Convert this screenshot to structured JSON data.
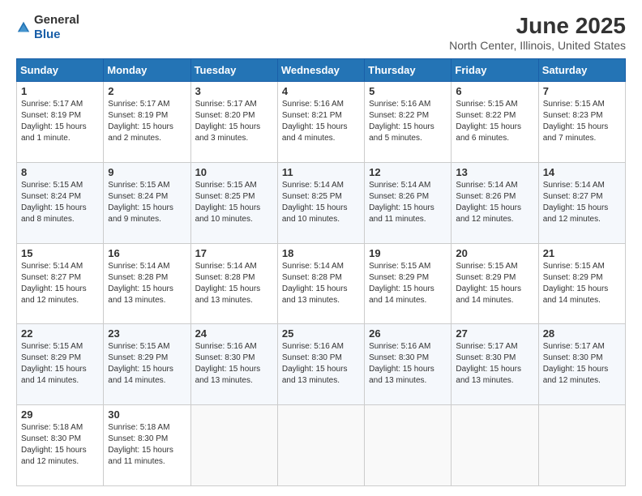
{
  "header": {
    "logo_general": "General",
    "logo_blue": "Blue",
    "title": "June 2025",
    "subtitle": "North Center, Illinois, United States"
  },
  "calendar": {
    "days_of_week": [
      "Sunday",
      "Monday",
      "Tuesday",
      "Wednesday",
      "Thursday",
      "Friday",
      "Saturday"
    ],
    "weeks": [
      [
        {
          "day": "1",
          "info": "Sunrise: 5:17 AM\nSunset: 8:19 PM\nDaylight: 15 hours\nand 1 minute."
        },
        {
          "day": "2",
          "info": "Sunrise: 5:17 AM\nSunset: 8:19 PM\nDaylight: 15 hours\nand 2 minutes."
        },
        {
          "day": "3",
          "info": "Sunrise: 5:17 AM\nSunset: 8:20 PM\nDaylight: 15 hours\nand 3 minutes."
        },
        {
          "day": "4",
          "info": "Sunrise: 5:16 AM\nSunset: 8:21 PM\nDaylight: 15 hours\nand 4 minutes."
        },
        {
          "day": "5",
          "info": "Sunrise: 5:16 AM\nSunset: 8:22 PM\nDaylight: 15 hours\nand 5 minutes."
        },
        {
          "day": "6",
          "info": "Sunrise: 5:15 AM\nSunset: 8:22 PM\nDaylight: 15 hours\nand 6 minutes."
        },
        {
          "day": "7",
          "info": "Sunrise: 5:15 AM\nSunset: 8:23 PM\nDaylight: 15 hours\nand 7 minutes."
        }
      ],
      [
        {
          "day": "8",
          "info": "Sunrise: 5:15 AM\nSunset: 8:24 PM\nDaylight: 15 hours\nand 8 minutes."
        },
        {
          "day": "9",
          "info": "Sunrise: 5:15 AM\nSunset: 8:24 PM\nDaylight: 15 hours\nand 9 minutes."
        },
        {
          "day": "10",
          "info": "Sunrise: 5:15 AM\nSunset: 8:25 PM\nDaylight: 15 hours\nand 10 minutes."
        },
        {
          "day": "11",
          "info": "Sunrise: 5:14 AM\nSunset: 8:25 PM\nDaylight: 15 hours\nand 10 minutes."
        },
        {
          "day": "12",
          "info": "Sunrise: 5:14 AM\nSunset: 8:26 PM\nDaylight: 15 hours\nand 11 minutes."
        },
        {
          "day": "13",
          "info": "Sunrise: 5:14 AM\nSunset: 8:26 PM\nDaylight: 15 hours\nand 12 minutes."
        },
        {
          "day": "14",
          "info": "Sunrise: 5:14 AM\nSunset: 8:27 PM\nDaylight: 15 hours\nand 12 minutes."
        }
      ],
      [
        {
          "day": "15",
          "info": "Sunrise: 5:14 AM\nSunset: 8:27 PM\nDaylight: 15 hours\nand 12 minutes."
        },
        {
          "day": "16",
          "info": "Sunrise: 5:14 AM\nSunset: 8:28 PM\nDaylight: 15 hours\nand 13 minutes."
        },
        {
          "day": "17",
          "info": "Sunrise: 5:14 AM\nSunset: 8:28 PM\nDaylight: 15 hours\nand 13 minutes."
        },
        {
          "day": "18",
          "info": "Sunrise: 5:14 AM\nSunset: 8:28 PM\nDaylight: 15 hours\nand 13 minutes."
        },
        {
          "day": "19",
          "info": "Sunrise: 5:15 AM\nSunset: 8:29 PM\nDaylight: 15 hours\nand 14 minutes."
        },
        {
          "day": "20",
          "info": "Sunrise: 5:15 AM\nSunset: 8:29 PM\nDaylight: 15 hours\nand 14 minutes."
        },
        {
          "day": "21",
          "info": "Sunrise: 5:15 AM\nSunset: 8:29 PM\nDaylight: 15 hours\nand 14 minutes."
        }
      ],
      [
        {
          "day": "22",
          "info": "Sunrise: 5:15 AM\nSunset: 8:29 PM\nDaylight: 15 hours\nand 14 minutes."
        },
        {
          "day": "23",
          "info": "Sunrise: 5:15 AM\nSunset: 8:29 PM\nDaylight: 15 hours\nand 14 minutes."
        },
        {
          "day": "24",
          "info": "Sunrise: 5:16 AM\nSunset: 8:30 PM\nDaylight: 15 hours\nand 13 minutes."
        },
        {
          "day": "25",
          "info": "Sunrise: 5:16 AM\nSunset: 8:30 PM\nDaylight: 15 hours\nand 13 minutes."
        },
        {
          "day": "26",
          "info": "Sunrise: 5:16 AM\nSunset: 8:30 PM\nDaylight: 15 hours\nand 13 minutes."
        },
        {
          "day": "27",
          "info": "Sunrise: 5:17 AM\nSunset: 8:30 PM\nDaylight: 15 hours\nand 13 minutes."
        },
        {
          "day": "28",
          "info": "Sunrise: 5:17 AM\nSunset: 8:30 PM\nDaylight: 15 hours\nand 12 minutes."
        }
      ],
      [
        {
          "day": "29",
          "info": "Sunrise: 5:18 AM\nSunset: 8:30 PM\nDaylight: 15 hours\nand 12 minutes."
        },
        {
          "day": "30",
          "info": "Sunrise: 5:18 AM\nSunset: 8:30 PM\nDaylight: 15 hours\nand 11 minutes."
        },
        {
          "day": "",
          "info": ""
        },
        {
          "day": "",
          "info": ""
        },
        {
          "day": "",
          "info": ""
        },
        {
          "day": "",
          "info": ""
        },
        {
          "day": "",
          "info": ""
        }
      ]
    ]
  }
}
